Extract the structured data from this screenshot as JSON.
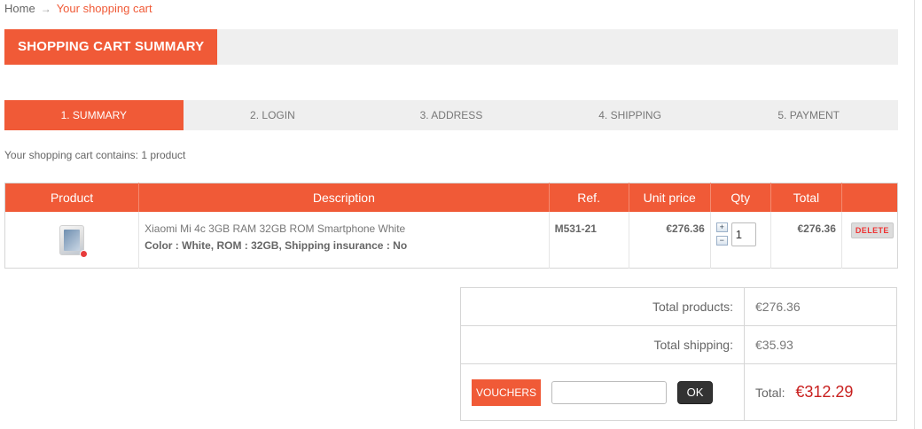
{
  "breadcrumb": {
    "home": "Home",
    "current": "Your shopping cart"
  },
  "page": {
    "title": "SHOPPING CART SUMMARY",
    "cart_count_text": "Your shopping cart contains: 1 product"
  },
  "steps": [
    {
      "label": "1. SUMMARY",
      "active": true
    },
    {
      "label": "2. LOGIN",
      "active": false
    },
    {
      "label": "3. ADDRESS",
      "active": false
    },
    {
      "label": "4. SHIPPING",
      "active": false
    },
    {
      "label": "5. PAYMENT",
      "active": false
    }
  ],
  "table": {
    "headers": [
      "Product",
      "Description",
      "Ref.",
      "Unit price",
      "Qty",
      "Total",
      ""
    ],
    "rows": [
      {
        "name": "Xiaomi Mi 4c 3GB RAM 32GB ROM Smartphone White",
        "attributes": "Color : White, ROM : 32GB, Shipping insurance : No",
        "ref": "M531-21",
        "unit_price": "€276.36",
        "qty": "1",
        "total": "€276.36",
        "delete_label": "DELETE"
      }
    ]
  },
  "summary": {
    "total_products_label": "Total products:",
    "total_products_value": "€276.36",
    "total_shipping_label": "Total shipping:",
    "total_shipping_value": "€35.93",
    "vouchers_label": "VOUCHERS",
    "voucher_placeholder": "",
    "ok_label": "OK",
    "total_label": "Total:",
    "total_value": "€312.29"
  },
  "icons": {
    "qty_up": "plus-icon",
    "qty_down": "minus-icon",
    "breadcrumb_separator": "arrow-right-icon"
  },
  "colors": {
    "accent": "#f05a37",
    "price_red": "#c8201f",
    "panel_grey": "#efefef"
  }
}
